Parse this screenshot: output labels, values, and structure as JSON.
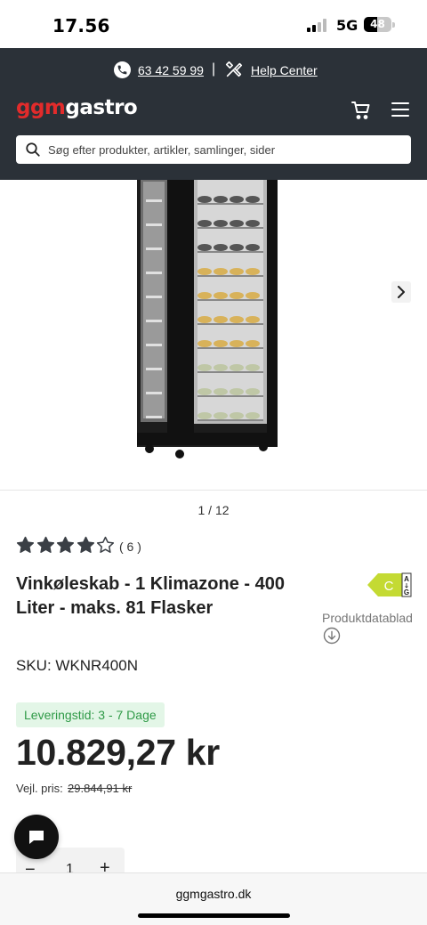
{
  "status_bar": {
    "time": "17.56",
    "network": "5G",
    "battery": "48",
    "battery_level": 0.48
  },
  "header": {
    "phone": "63 42 59 99",
    "separator": "|",
    "help_center": "Help Center",
    "logo_part1": "ggm",
    "logo_part2": "gastro",
    "search_placeholder": "Søg efter produkter, artikler, samlinger, sider",
    "colors": {
      "background": "#2b3138",
      "logo_red": "#e22b2b"
    }
  },
  "gallery": {
    "pager": "1 / 12"
  },
  "product": {
    "rating": 4,
    "rating_max": 5,
    "rating_count": "( 6 )",
    "title": "Vinkøleskab - 1 Klimazone - 400 Liter - maks. 81 Flasker",
    "energy_class": "C",
    "energy_scale_top": "A",
    "energy_scale_bottom": "G",
    "datasheet_label": "Produktdatablad",
    "sku": "SKU: WKNR400N",
    "delivery": "Leveringstid: 3 - 7 Dage",
    "price": "10.829,27 kr",
    "rrp_label": "Vejl. pris:",
    "rrp_value": "29.844,91 kr",
    "quantity": "1",
    "qty_minus": "−",
    "qty_plus": "+"
  },
  "browser": {
    "url": "ggmgastro.dk"
  }
}
